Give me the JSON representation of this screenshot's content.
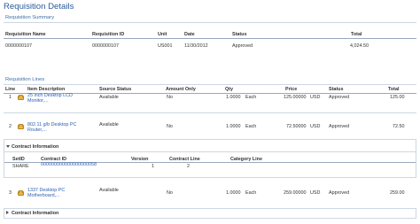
{
  "page": {
    "title": "Requisition Details"
  },
  "summary": {
    "section_label": "Requisition Summary",
    "headers": {
      "name": "Requisition Name",
      "id": "Requisition ID",
      "unit": "Unit",
      "date": "Date",
      "status": "Status",
      "total": "Total"
    },
    "row": {
      "name": "0000000107",
      "id": "0000000107",
      "unit": "US001",
      "date": "11/30/2012",
      "status": "Approved",
      "total": "4,024.50"
    }
  },
  "lines": {
    "section_label": "Requisition Lines",
    "headers": {
      "line": "Line",
      "item": "Item Description",
      "source_status": "Source Status",
      "amount_only": "Amount Only",
      "qty": "Qty",
      "price": "Price",
      "status": "Status",
      "total": "Total"
    },
    "rows": [
      {
        "line": "1",
        "item_line1": "25 inch Desktop LCD",
        "item_line2": "Monitor,...",
        "source_status": "Available",
        "amount_only": "No",
        "qty": "1.0000",
        "uom": "Each",
        "price": "125.00000",
        "currency": "USD",
        "status": "Approved",
        "total": "125.00"
      },
      {
        "line": "2",
        "item_line1": "802.11 g/b Desktop PC",
        "item_line2": "Router,...",
        "source_status": "Available",
        "amount_only": "No",
        "qty": "1.0000",
        "uom": "Each",
        "price": "72.50000",
        "currency": "USD",
        "status": "Approved",
        "total": "72.50"
      },
      {
        "line": "3",
        "item_line1": "1337 Desktop PC",
        "item_line2": "Motherboard,...",
        "source_status": "Available",
        "amount_only": "No",
        "qty": "1.0000",
        "uom": "Each",
        "price": "259.00000",
        "currency": "USD",
        "status": "Approved",
        "total": "259.00"
      }
    ]
  },
  "contract": {
    "label": "Contract Information",
    "headers": {
      "setid": "SetID",
      "contract_id": "Contract ID",
      "version": "Version",
      "contract_line": "Contract Line",
      "category_line": "Category Line"
    },
    "row": {
      "setid": "SHARE",
      "contract_id": "000000000000000000058",
      "version": "1",
      "contract_line": "2",
      "category_line": ""
    },
    "collapsed_label": "Contract Information"
  }
}
